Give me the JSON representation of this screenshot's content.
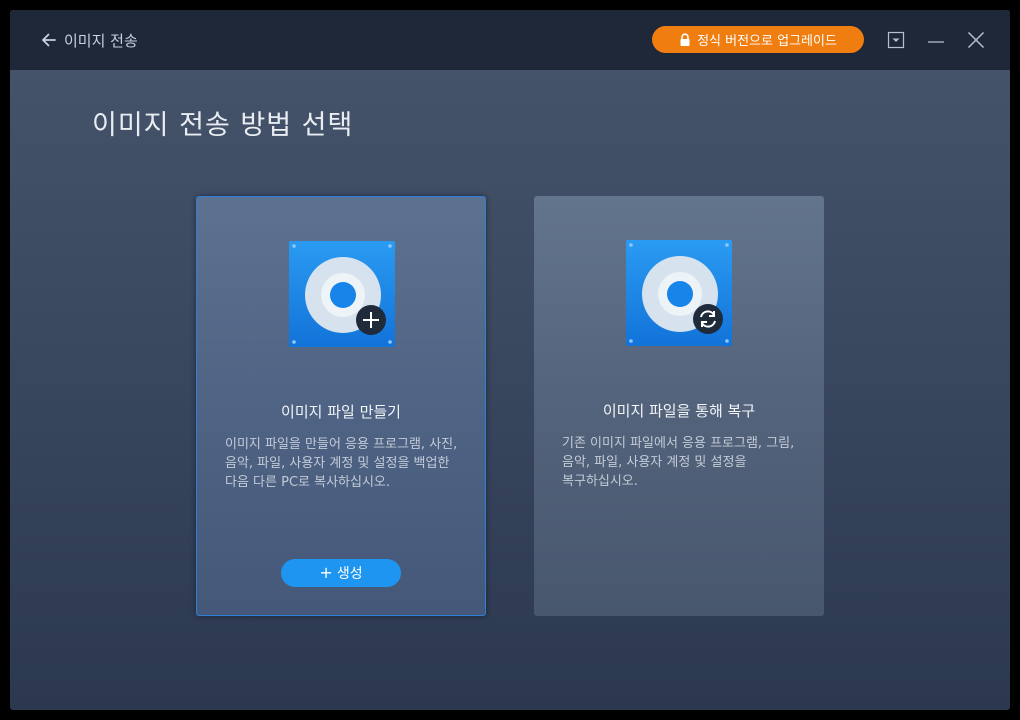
{
  "window": {
    "title": "이미지 전송",
    "upgrade_label": "정식 버전으로 업그레이드"
  },
  "page": {
    "title": "이미지 전송 방법 선택"
  },
  "cards": [
    {
      "title": "이미지 파일 만들기",
      "description": "이미지 파일을 만들어 응용 프로그램, 사진, 음악, 파일, 사용자 계정 및 설정을 백업한 다음 다른 PC로 복사하십시오.",
      "button_label": "생성",
      "selected": true,
      "icon": "disk-add-icon"
    },
    {
      "title": "이미지 파일을 통해 복구",
      "description": "기존 이미지 파일에서 응용 프로그램, 그림, 음악, 파일, 사용자 계정 및 설정을 복구하십시오.",
      "selected": false,
      "icon": "disk-restore-icon"
    }
  ],
  "colors": {
    "accent": "#1e95f0",
    "upgrade": "#f07d10",
    "titlebar": "#1e2839",
    "selected_border": "#2f7ed8"
  }
}
